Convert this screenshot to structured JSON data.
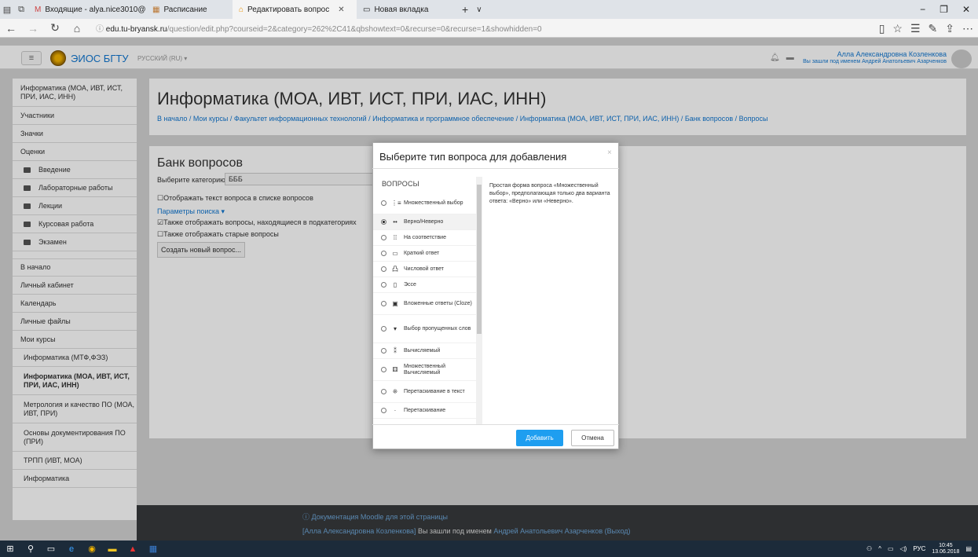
{
  "browser": {
    "tabs": [
      {
        "label": "Входящие - alya.nice3010@",
        "icon": "mail-icon"
      },
      {
        "label": "Расписание",
        "icon": "calendar-icon"
      },
      {
        "label": "Редактировать вопрос",
        "icon": "moodle-icon",
        "active": true
      },
      {
        "label": "Новая вкладка",
        "icon": "newtab-icon"
      }
    ],
    "url_host": "edu.tu-bryansk.ru",
    "url_path": "/question/edit.php?courseid=2&category=262%2C41&qbshowtext=0&recurse=0&recurse=1&showhidden=0"
  },
  "header": {
    "site_name": "ЭИОС БГТУ",
    "language": "РУССКИЙ (RU) ▾",
    "user_name": "Алла Александровна Козленкова",
    "login_as": "Вы зашли под именем Андрей Анатольевич Азарченков"
  },
  "drawer": {
    "course": "Информатика (МОА, ИВТ, ИСТ, ПРИ, ИАС, ИНН)",
    "items": [
      "Участники",
      "Значки",
      "Оценки"
    ],
    "sections": [
      "Введение",
      "Лабораторные работы",
      "Лекции",
      "Курсовая работа",
      "Экзамен"
    ],
    "nav": [
      "В начало",
      "Личный кабинет",
      "Календарь",
      "Личные файлы",
      "Мои курсы"
    ],
    "courses": [
      "Информатика (МТФ,ФЭЗ)",
      "Информатика (МОА, ИВТ, ИСТ, ПРИ, ИАС, ИНН)",
      "Метрология и качество ПО (МОА, ИВТ, ПРИ)",
      "Основы документирования ПО (ПРИ)",
      "ТРПП (ИВТ, МОА)",
      "Информатика"
    ]
  },
  "main": {
    "course_title": "Информатика (МОА, ИВТ, ИСТ, ПРИ, ИАС, ИНН)",
    "breadcrumb": "В начало / Мои курсы / Факультет информационных технологий / Информатика и программное обеспечение / Информатика (МОА, ИВТ, ИСТ, ПРИ, ИАС, ИНН) / Банк вопросов / Вопросы",
    "bank_title": "Банк вопросов",
    "category_label": "Выберите категорию:",
    "category_value": "БББ",
    "show_text": "☐Отображать текст вопроса в списке вопросов",
    "search_options": "Параметры поиска ▾",
    "subcategories": "☑Также отображать вопросы, находящиеся в подкатегориях",
    "old_questions": "☐Также отображать старые вопросы",
    "create_button": "Создать новый вопрос..."
  },
  "modal": {
    "title": "Выберите тип вопроса для добавления",
    "close": "×",
    "list_header": "ВОПРОСЫ",
    "options": [
      {
        "label": "Множественный выбор",
        "icon": "⋮≡",
        "h": "h28"
      },
      {
        "label": "Верно/Неверно",
        "icon": "••",
        "h": "",
        "selected": true
      },
      {
        "label": "На соответствие",
        "icon": "⁞⁞",
        "h": ""
      },
      {
        "label": "Краткий ответ",
        "icon": "▭",
        "h": ""
      },
      {
        "label": "Числовой ответ",
        "icon": "凸",
        "h": ""
      },
      {
        "label": "Эссе",
        "icon": "▯",
        "h": ""
      },
      {
        "label": "Вложенные ответы (Cloze)",
        "icon": "▣",
        "h": "h28"
      },
      {
        "label": "Выбор пропущенных слов",
        "icon": "▾",
        "h": "h36"
      },
      {
        "label": "Вычисляемый",
        "icon": "⁑",
        "h": ""
      },
      {
        "label": "Множественный Вычисляемый",
        "icon": "⚅",
        "h": "h28"
      },
      {
        "label": "Перетаскивание в текст",
        "icon": "⁜",
        "h": "h28"
      },
      {
        "label": "Перетаскивание",
        "icon": "·",
        "h": ""
      }
    ],
    "description": "Простая форма вопроса «Множественный выбор», предполагающая только два варианта ответа: «Верно» или «Неверно».",
    "add_button": "Добавить",
    "cancel_button": "Отмена"
  },
  "footer": {
    "doc_link": "ⓘ Документация Moodle для этой страницы",
    "login_user": "[Алла Александровна Козленкова]",
    "login_text": " Вы зашли под именем ",
    "login_as": "Андрей Анатольевич Азарченков",
    "logout": "(Выход)"
  },
  "taskbar": {
    "lang": "РУС",
    "time": "10:45",
    "date": "13.06.2018"
  },
  "colors": {
    "accent": "#1177d1",
    "primary_button": "#1e9ef0",
    "footer": "#373a3c"
  }
}
